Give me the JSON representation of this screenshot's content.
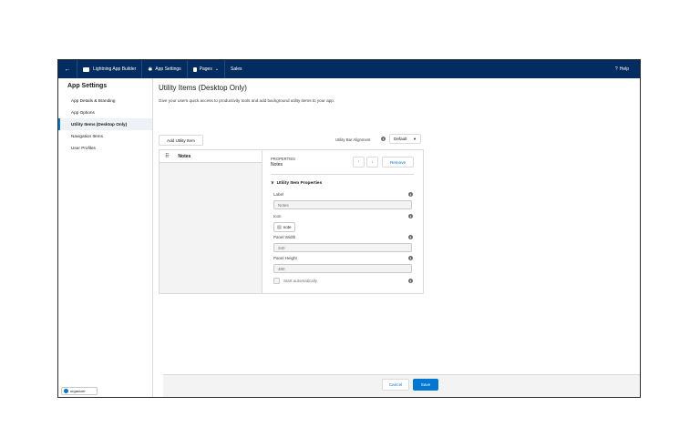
{
  "topbar": {
    "back_glyph": "←",
    "app_builder": "Lightning App Builder",
    "app_settings": "App Settings",
    "pages": "Pages",
    "pages_chevron": "⌄",
    "app_name": "Sales",
    "help_glyph": "?",
    "help": "Help"
  },
  "sidebar": {
    "title": "App Settings",
    "items": [
      {
        "label": "App Details & Branding"
      },
      {
        "label": "App Options"
      },
      {
        "label": "Utility Items (Desktop Only)"
      },
      {
        "label": "Navigation Items"
      },
      {
        "label": "User Profiles"
      }
    ],
    "active_index": 2,
    "organizer_label": "organizer"
  },
  "main": {
    "title": "Utility Items (Desktop Only)",
    "description": "Give your users quick access to productivity tools and add background utility items to your app.",
    "add_button": "Add Utility Item",
    "alignment_label": "Utility Bar Alignment",
    "alignment_value": "Default",
    "alignment_chevron": "▼"
  },
  "list": {
    "items": [
      {
        "label": "Notes"
      }
    ]
  },
  "properties": {
    "caption": "PROPERTIES",
    "name": "Notes",
    "up_glyph": "↑",
    "down_glyph": "↓",
    "remove_label": "Remove",
    "section_title": "Utility Item Properties",
    "chevron_glyph": "∨",
    "info_glyph": "i",
    "fields": {
      "label_label": "Label",
      "label_value": "Notes",
      "icon_label": "Icon",
      "icon_value": "note",
      "width_label": "Panel Width",
      "width_value": "340",
      "height_label": "Panel Height",
      "height_value": "480",
      "start_label": "Start automatically"
    }
  },
  "footer": {
    "cancel": "Cancel",
    "save": "Save"
  },
  "colors": {
    "nav_bg": "#032d60",
    "accent": "#0176d3",
    "border": "#dddbda"
  }
}
